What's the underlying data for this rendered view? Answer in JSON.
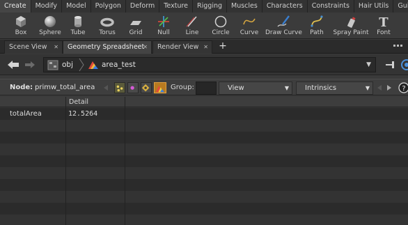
{
  "shelf_tabs": [
    "Create",
    "Modify",
    "Model",
    "Polygon",
    "Deform",
    "Texture",
    "Rigging",
    "Muscles",
    "Characters",
    "Constraints",
    "Hair Utils",
    "Guide Process"
  ],
  "tools": [
    {
      "label": "Box",
      "icon": "box-icon"
    },
    {
      "label": "Sphere",
      "icon": "sphere-icon"
    },
    {
      "label": "Tube",
      "icon": "tube-icon"
    },
    {
      "label": "Torus",
      "icon": "torus-icon"
    },
    {
      "label": "Grid",
      "icon": "grid-icon"
    },
    {
      "label": "Null",
      "icon": "null-icon"
    },
    {
      "label": "Line",
      "icon": "line-icon"
    },
    {
      "label": "Circle",
      "icon": "circle-icon"
    },
    {
      "label": "Curve",
      "icon": "curve-icon"
    },
    {
      "label": "Draw Curve",
      "icon": "draw-curve-icon"
    },
    {
      "label": "Path",
      "icon": "path-icon"
    },
    {
      "label": "Spray Paint",
      "icon": "spray-paint-icon"
    },
    {
      "label": "Font",
      "icon": "font-icon"
    }
  ],
  "pane_tabs": [
    {
      "label": "Scene View",
      "active": false
    },
    {
      "label": "Geometry Spreadsheet",
      "active": true
    },
    {
      "label": "Render View",
      "active": false
    }
  ],
  "add_tab_symbol": "+",
  "path": {
    "root": "obj",
    "node": "area_test"
  },
  "node_row": {
    "node_label": "Node:",
    "node_name": "primw_total_area",
    "group_label": "Group:",
    "view_label": "View",
    "intrinsics_label": "Intrinsics"
  },
  "sheet": {
    "columns": [
      "",
      "Detail"
    ],
    "rows": [
      {
        "name": "totalArea",
        "value": "12.5264"
      }
    ]
  },
  "colors": {
    "accent_orange": "#d7902a",
    "selected_tab": "#454545"
  }
}
